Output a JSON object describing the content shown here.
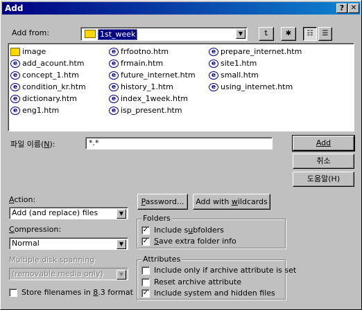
{
  "window": {
    "title": "Add"
  },
  "title_buttons": {
    "help": "?",
    "close": "✕"
  },
  "add_from": {
    "label": "Add from:",
    "value": "1st_week"
  },
  "toolbar": {
    "up_icon": "up-folder-icon",
    "new_folder_icon": "new-folder-icon",
    "list_view_icon": "list-view-icon",
    "details_view_icon": "details-view-icon"
  },
  "files": {
    "col1": [
      {
        "name": "image",
        "type": "folder"
      },
      {
        "name": "add_acount.htm",
        "type": "htm"
      },
      {
        "name": "concept_1.htm",
        "type": "htm"
      },
      {
        "name": "condition_kr.htm",
        "type": "htm"
      },
      {
        "name": "dictionary.htm",
        "type": "htm"
      },
      {
        "name": "eng1.htm",
        "type": "htm"
      }
    ],
    "col2": [
      {
        "name": "frfootno.htm",
        "type": "htm"
      },
      {
        "name": "frmain.htm",
        "type": "htm"
      },
      {
        "name": "future_internet.htm",
        "type": "htm"
      },
      {
        "name": "history_1.htm",
        "type": "htm"
      },
      {
        "name": "index_1week.htm",
        "type": "htm"
      },
      {
        "name": "isp_present.htm",
        "type": "htm"
      }
    ],
    "col3": [
      {
        "name": "prepare_internet.htm",
        "type": "htm"
      },
      {
        "name": "site1.htm",
        "type": "htm"
      },
      {
        "name": "small.htm",
        "type": "htm"
      },
      {
        "name": "using_internet.htm",
        "type": "htm"
      }
    ]
  },
  "filename": {
    "label": "파일 이름(N):",
    "value": "*.*"
  },
  "buttons": {
    "add": "Add",
    "cancel": "취소",
    "help": "도움말(H)",
    "password": "Password...",
    "add_with_wildcards": "Add with wildcards"
  },
  "action": {
    "label": "Action:",
    "value": "Add (and replace) files"
  },
  "compression": {
    "label": "Compression:",
    "value": "Normal"
  },
  "spanning": {
    "label": "Multiple disk spanning",
    "value": "(removable media only)"
  },
  "store_83": {
    "label": "Store filenames in 8.3 format",
    "checked": false
  },
  "folders": {
    "legend": "Folders",
    "include_subfolders": {
      "label": "Include subfolders",
      "checked": true
    },
    "save_extra": {
      "label": "Save extra folder info",
      "checked": true
    }
  },
  "attributes": {
    "legend": "Attributes",
    "only_archive": {
      "label": "Include only if archive attribute is set",
      "checked": false
    },
    "reset_archive": {
      "label": "Reset archive attribute",
      "checked": false
    },
    "include_system": {
      "label": "Include system and hidden files",
      "checked": true
    }
  },
  "check_mark": "✓"
}
